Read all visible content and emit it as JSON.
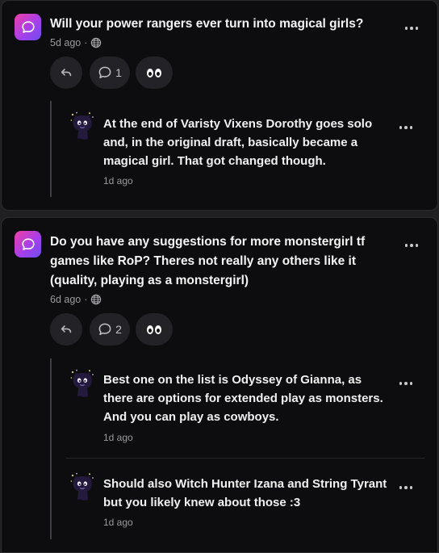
{
  "posts": [
    {
      "question": "Will your power rangers ever turn into magical girls?",
      "time": "5d ago",
      "separator": "·",
      "comment_count": "1",
      "replies": [
        {
          "text": "At the end of Varisty Vixens Dorothy goes solo and, in the original draft, basically became a magical girl. That got changed though.",
          "time": "1d ago"
        }
      ]
    },
    {
      "question": "Do you have any suggestions for more monstergirl tf games like RoP? Theres not really any others like it (quality, playing as a monstergirl)",
      "time": "6d ago",
      "separator": "·",
      "comment_count": "2",
      "replies": [
        {
          "text": "Best one on the list is Odyssey of Gianna, as there are options for extended play as monsters. And you can play as cowboys.",
          "time": "1d ago"
        },
        {
          "text": "Should also Witch Hunter Izana and String Tyrant but you likely knew about those :3",
          "time": "1d ago"
        }
      ]
    }
  ],
  "icons": {
    "ask": "speech-bubble-icon",
    "globe": "globe-icon",
    "reply": "reply-arrow-icon",
    "comment": "comment-icon",
    "react": "eyes-icon",
    "more": "more-options-icon"
  },
  "colors": {
    "card_bg": "#0d0d0f",
    "page_bg": "#202022",
    "button_bg": "#232327",
    "ask_gradient_start": "#ef3fa6",
    "ask_gradient_end": "#6d4ef0",
    "muted_text": "#9a9a9f"
  }
}
